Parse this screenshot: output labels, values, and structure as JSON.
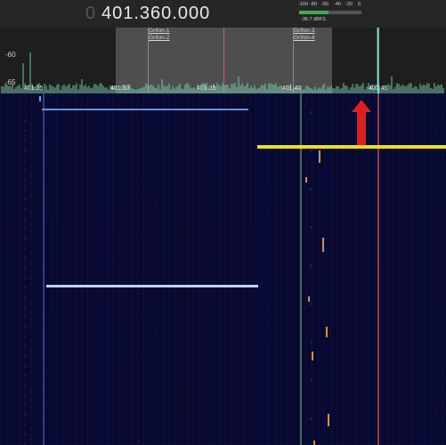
{
  "frequency": {
    "prefix": "0",
    "value": "401.360.000"
  },
  "meter": {
    "scale": [
      "-100",
      "-80",
      "-60",
      "-40",
      "-20",
      "0"
    ],
    "level_fraction": 0.47,
    "readout": "-36.7 dBFS",
    "fill_color": "#35b44a"
  },
  "spectrum": {
    "db_labels": [
      "-60",
      "-65"
    ],
    "freq_ticks": [
      "401.25",
      "401.30",
      "401.35",
      "401.40",
      "401.45"
    ],
    "channels": [
      {
        "a": "Grifon-1",
        "b": "Grifon-2"
      },
      {
        "a": "Grifon-3",
        "b": "Grifon-4"
      }
    ],
    "trace_color": "#7fe0c8",
    "center_line_color": "#d95a5a"
  },
  "annotation": {
    "arrow_color": "#e01e1e",
    "icon": "red-arrow-up-icon"
  },
  "waterfall": {
    "colors": {
      "background": "#07072a",
      "weak_signal": "#6ea0ff",
      "strong_signal": "#f2e200",
      "tuned_line": "#e07060",
      "marker_line": "#8fd8a0"
    }
  }
}
